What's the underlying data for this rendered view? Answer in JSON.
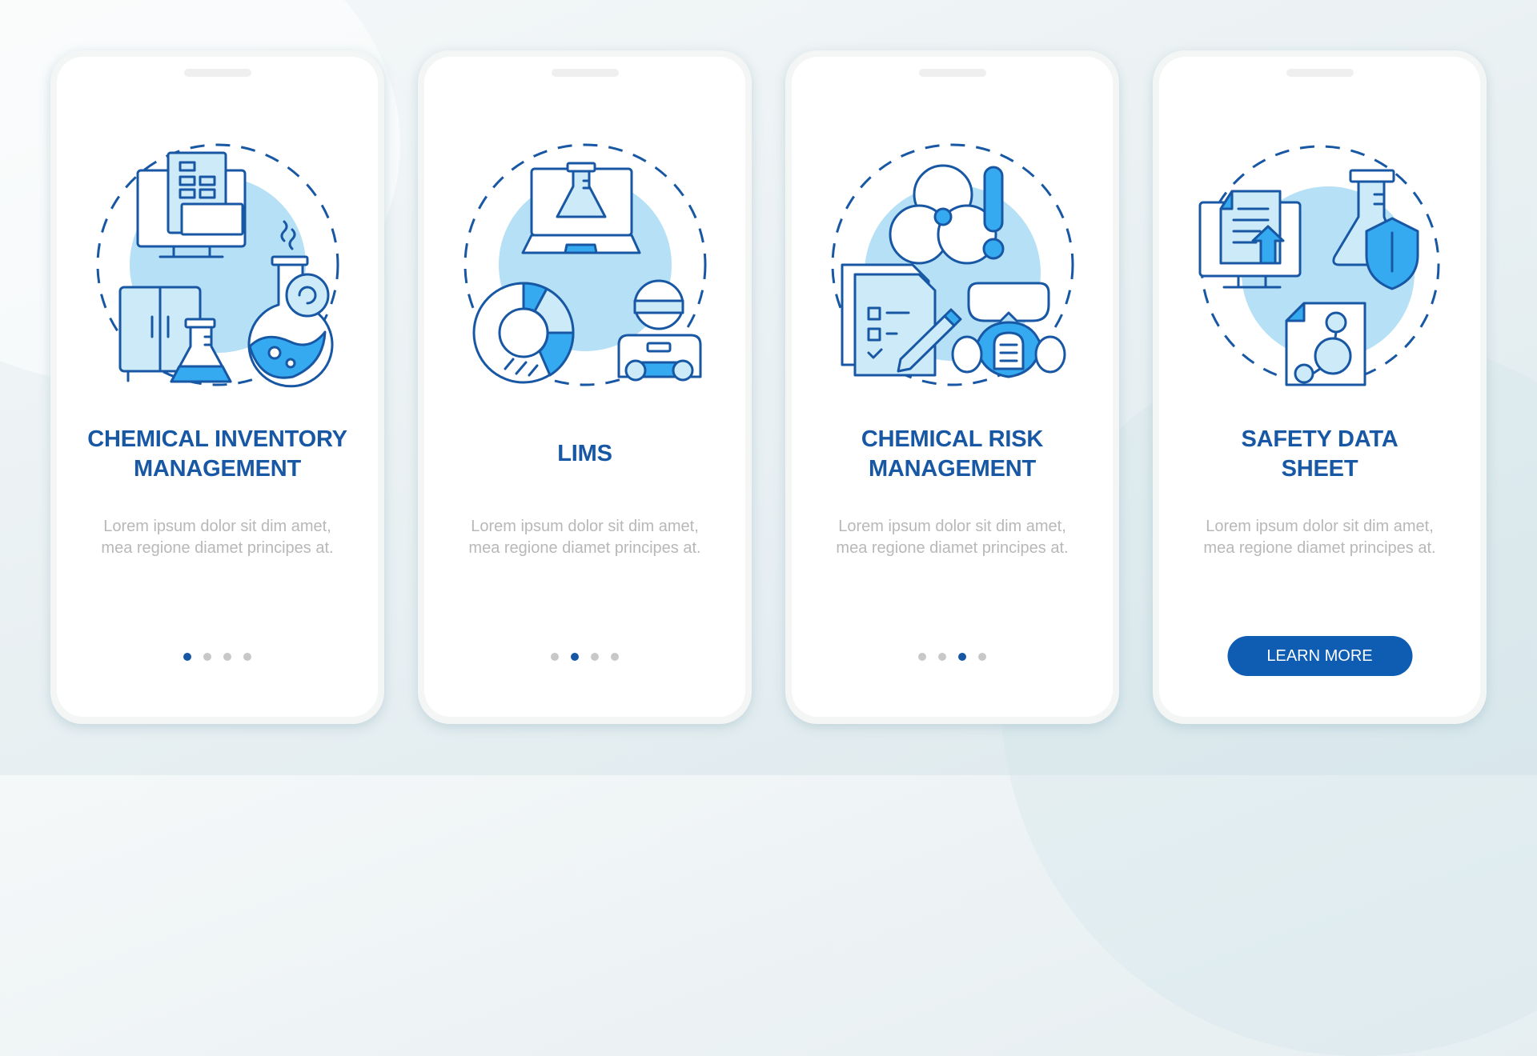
{
  "colors": {
    "accent": "#1757a4",
    "button": "#0f5cb3",
    "illustration_fill": "#35aaf0",
    "illustration_light": "#b6e0f6",
    "body_text": "#b8b8b8",
    "dot_inactive": "#c8c8c8"
  },
  "cards": [
    {
      "title_line1": "CHEMICAL INVENTORY",
      "title_line2": "MANAGEMENT",
      "description": "Lorem ipsum dolor sit dim amet, mea regione diamet principes at.",
      "illustration": [
        "monitor-with-document-icon",
        "cabinet-icon",
        "erlenmeyer-flask-icon",
        "round-flask-refresh-icon"
      ],
      "page_indicator": {
        "total": 4,
        "active": 1
      }
    },
    {
      "title_line1": "LIMS",
      "description": "Lorem ipsum dolor sit dim amet, mea regione diamet principes at.",
      "illustration": [
        "laptop-flask-icon",
        "donut-chart-icon",
        "scientist-with-goggles-icon"
      ],
      "page_indicator": {
        "total": 4,
        "active": 2
      }
    },
    {
      "title_line1": "CHEMICAL RISK",
      "title_line2": "MANAGEMENT",
      "description": "Lorem ipsum dolor sit dim amet, mea regione diamet principes at.",
      "illustration": [
        "biohazard-icon",
        "exclamation-icon",
        "checklist-pencil-icon",
        "gas-mask-goggles-icon"
      ],
      "page_indicator": {
        "total": 4,
        "active": 3
      }
    },
    {
      "title_line1": "SAFETY DATA",
      "title_line2": "SHEET",
      "description": "Lorem ipsum dolor sit dim amet, mea regione diamet principes at.",
      "illustration": [
        "monitor-upload-document-icon",
        "flask-shield-icon",
        "molecule-document-icon"
      ],
      "button_label": "LEARN MORE"
    }
  ]
}
